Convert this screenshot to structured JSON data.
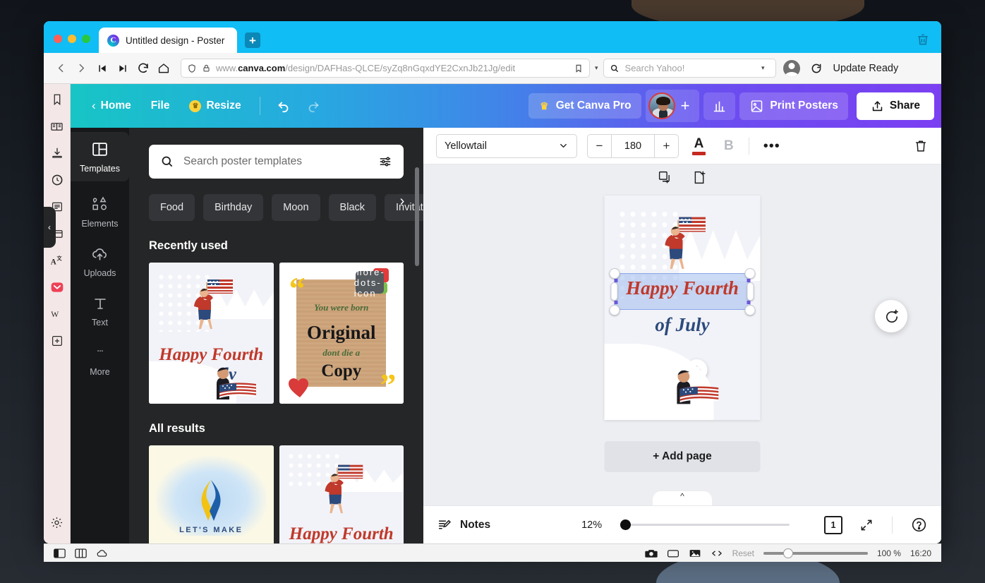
{
  "browser": {
    "tab": {
      "title": "Untitled design - Poster",
      "favicon": "canva-icon",
      "new_tab_label": "+"
    },
    "trash_icon": "trash-icon",
    "nav": {
      "back": "back-icon",
      "forward": "forward-icon",
      "first": "skip-back-icon",
      "last": "skip-forward-icon",
      "reload": "reload-icon",
      "home": "home-icon"
    },
    "url": {
      "shield_icon": "shield-icon",
      "lock_icon": "lock-icon",
      "prefix": "www.",
      "domain": "canva.com",
      "path": "/design/DAFHas-QLCE/syZq8nGqxdYE2CxnJb21Jg/edit",
      "bookmark_icon": "bookmark-icon",
      "dropdown": "▾"
    },
    "search": {
      "placeholder": "Search Yahoo!",
      "icon": "search-icon",
      "dropdown": "▾"
    },
    "account_icon": "account-icon",
    "update": {
      "icon": "refresh-icon",
      "label": "Update Ready"
    },
    "sidebar_icons": [
      "bookmark-icon",
      "reader-icon",
      "downloads-icon",
      "history-icon",
      "notes-icon",
      "tabs-icon",
      "translate-icon",
      "pocket-icon",
      "wikipedia-icon",
      "add-extension-icon"
    ],
    "sidebar_bottom_icon": "settings-gear-icon"
  },
  "canva": {
    "topbar": {
      "back_chevron": "‹",
      "home": "Home",
      "file": "File",
      "resize": "Resize",
      "resize_icon": "crown-icon",
      "undo_icon": "undo-icon",
      "redo_icon": "redo-icon",
      "get_pro": "Get Canva Pro",
      "get_pro_icon": "crown-icon",
      "avatar": "user-avatar",
      "add_collaborator": "+",
      "analytics_icon": "bar-chart-icon",
      "print_icon": "print-image-icon",
      "print_posters": "Print Posters",
      "share": "Share",
      "share_icon": "share-upload-icon"
    },
    "rail": [
      {
        "label": "Templates",
        "icon": "templates-icon",
        "active": true
      },
      {
        "label": "Elements",
        "icon": "elements-icon",
        "active": false
      },
      {
        "label": "Uploads",
        "icon": "uploads-cloud-icon",
        "active": false
      },
      {
        "label": "Text",
        "icon": "text-icon",
        "active": false
      },
      {
        "label": "More",
        "icon": "more-dots-icon",
        "active": false
      }
    ],
    "panel": {
      "search_placeholder": "Search poster templates",
      "search_icon": "search-icon",
      "filter_icon": "filter-sliders-icon",
      "chips": [
        "Food",
        "Birthday",
        "Moon",
        "Black",
        "Invitation"
      ],
      "chips_next_icon": "chevron-right-icon",
      "recently_used_title": "Recently used",
      "all_results_title": "All results",
      "collapse_icon": "chevron-left-icon",
      "templates": {
        "july4_happy": "Happy Fourth",
        "july4_of": "of July",
        "orig_line1": "You were born",
        "orig_line2": "Original",
        "orig_line3": "dont die a",
        "orig_line4": "Copy",
        "orig_menu_icon": "more-dots-icon",
        "ribbon_text": "LET'S MAKE"
      }
    },
    "editor": {
      "font_name": "Yellowtail",
      "font_dropdown_icon": "chevron-down-icon",
      "size_minus": "−",
      "font_size": "180",
      "size_plus": "+",
      "text_color_glyph": "A",
      "text_color_hex": "#c5291f",
      "bold_glyph": "B",
      "more_options": "•••",
      "delete_icon": "trash-icon",
      "page_duplicate_icon": "duplicate-page-icon",
      "page_add_icon": "add-page-icon",
      "rotate_icon": "rotate-icon",
      "move_icon": "move-icon",
      "comment_icon": "add-comment-icon",
      "add_page_label": "+ Add page",
      "canvas": {
        "title_line1": "Happy Fourth",
        "title_line2": "of July",
        "title_color1": "#c0392b",
        "title_color2": "#2c4a7c"
      },
      "bottom": {
        "notes_label": "Notes",
        "notes_icon": "notes-pencil-icon",
        "zoom_level": "12%",
        "page_number": "1",
        "expand_icon": "fullscreen-icon",
        "help_icon": "help-icon",
        "collapse_icon": "chevron-up-icon"
      }
    }
  },
  "os_bar": {
    "left_icons": [
      "sidebar-left-icon",
      "split-view-icon",
      "cloud-icon"
    ],
    "right_icons": [
      "camera-icon",
      "rectangle-icon",
      "image-icon",
      "code-icon"
    ],
    "reset_label": "Reset",
    "zoom_label": "100 %",
    "clock": "16:20"
  }
}
